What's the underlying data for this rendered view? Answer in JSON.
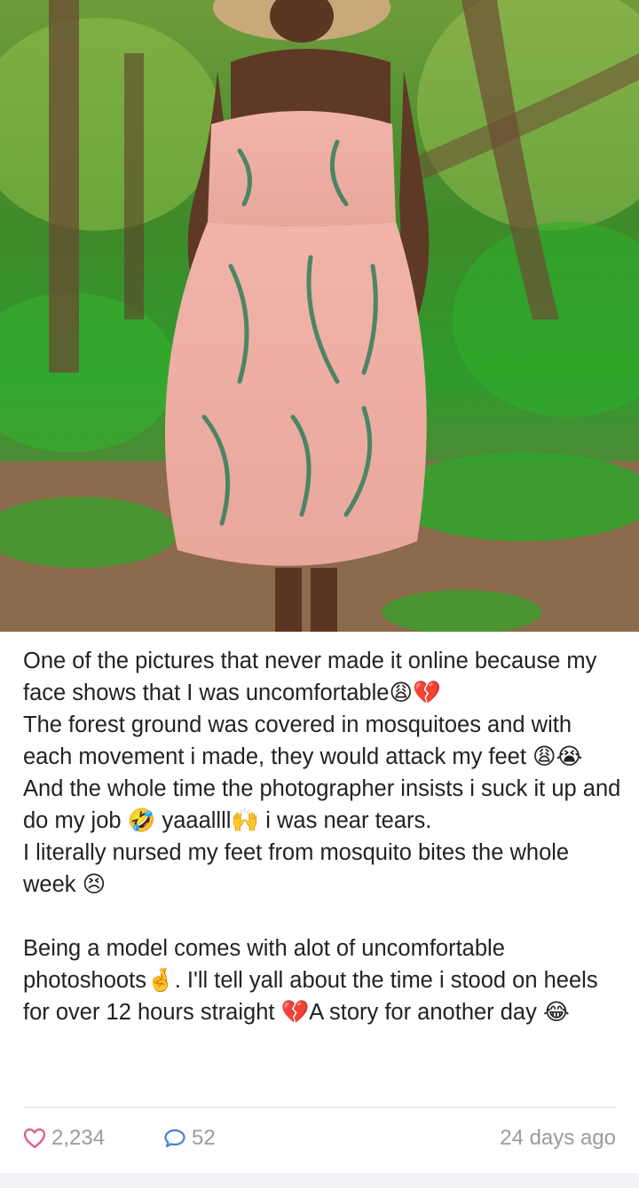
{
  "post": {
    "photo": {
      "subject": "woman-in-pink-floral-dress-photo"
    },
    "caption": {
      "paragraph1": "One of the pictures that never made it online because my face shows that I was uncomfortable😩💔\nThe forest ground was covered in mosquitoes and with each movement i made, they would attack my feet 😩😭 And the whole time the photographer insists i suck it up and do my job 🤣 yaaallll🙌 i was near tears.\nI literally nursed my feet from mosquito bites the whole week 😣",
      "paragraph2": "Being a model comes with alot of uncomfortable photoshoots🤞. I'll tell yall about the time i stood on heels for over 12 hours straight 💔A story for another day 😂"
    },
    "footer": {
      "likes_count": "2,234",
      "comments_count": "52",
      "timestamp": "24 days ago"
    },
    "icons": {
      "like": "heart-outline-icon",
      "comment": "speech-bubble-icon"
    },
    "colors": {
      "like_icon": "#e0587a",
      "comment_icon": "#4a7fd6",
      "meta_text": "#9a9aa3",
      "body_text": "#222222"
    }
  }
}
